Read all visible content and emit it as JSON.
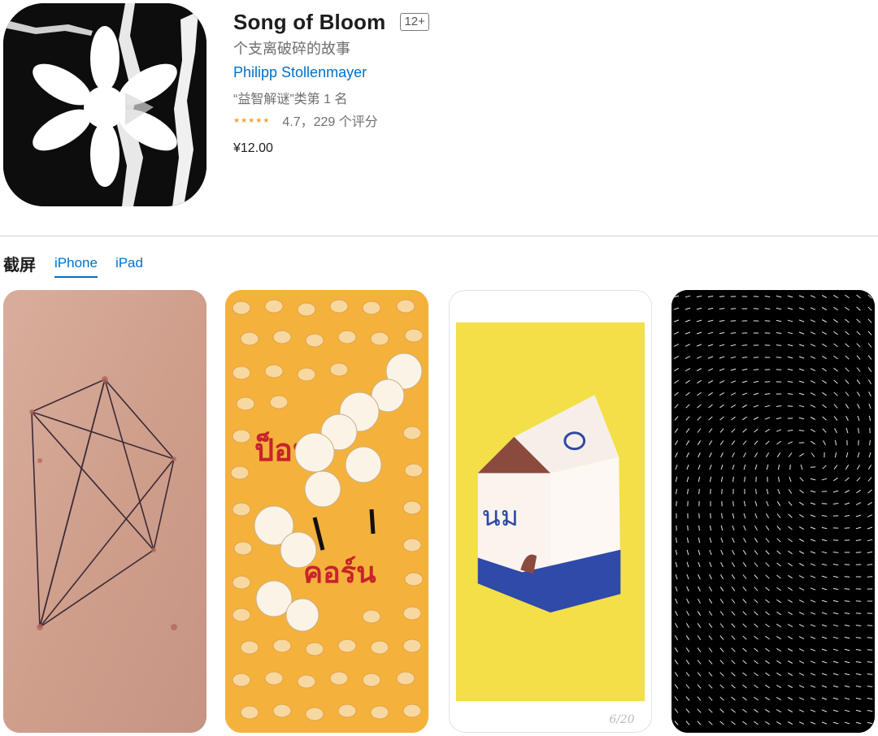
{
  "app": {
    "title": "Song of Bloom",
    "age_rating": "12+",
    "subtitle": "个支离破碎的故事",
    "developer": "Philipp Stollenmayer",
    "rank_text": "“益智解谜”类第 1 名",
    "rating": {
      "stars": 4.7,
      "text": "4.7，229 个评分"
    },
    "price": "¥12.00",
    "icon": "torn-paper-flower-icon"
  },
  "screenshots_section": {
    "title": "截屏",
    "tabs": [
      {
        "label": "iPhone",
        "selected": true
      },
      {
        "label": "iPad",
        "selected": false
      }
    ],
    "screenshots": [
      {
        "name": "stitched-skin-screenshot"
      },
      {
        "name": "popcorn-screenshot",
        "text": "ป็อปคอร์น"
      },
      {
        "name": "milk-carton-screenshot",
        "text": "นม",
        "signature": "6/20"
      },
      {
        "name": "dot-field-screenshot"
      }
    ]
  },
  "colors": {
    "link": "#0070c9",
    "star": "#f4a433",
    "secondary_text": "#6e6e73"
  }
}
